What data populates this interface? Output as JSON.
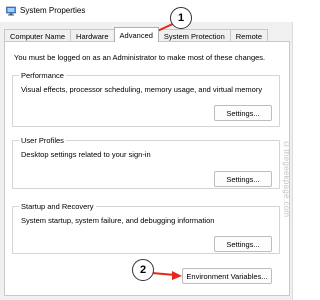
{
  "window": {
    "title": "System Properties",
    "icon": "system-properties-icon"
  },
  "tabs": [
    {
      "label": "Computer Name",
      "active": false
    },
    {
      "label": "Hardware",
      "active": false
    },
    {
      "label": "Advanced",
      "active": true
    },
    {
      "label": "System Protection",
      "active": false
    },
    {
      "label": "Remote",
      "active": false
    }
  ],
  "advanced": {
    "admin_note": "You must be logged on as an Administrator to make most of these changes.",
    "performance": {
      "title": "Performance",
      "description": "Visual effects, processor scheduling, memory usage, and virtual memory",
      "button": "Settings..."
    },
    "user_profiles": {
      "title": "User Profiles",
      "description": "Desktop settings related to your sign-in",
      "button": "Settings..."
    },
    "startup_recovery": {
      "title": "Startup and Recovery",
      "description": "System startup, system failure, and debugging information",
      "button": "Settings..."
    },
    "env_button": "Environment Variables..."
  },
  "annotations": {
    "step1": "1",
    "step2": "2",
    "arrow_color": "#e8261c"
  },
  "watermark": "©thegeekpage.com"
}
